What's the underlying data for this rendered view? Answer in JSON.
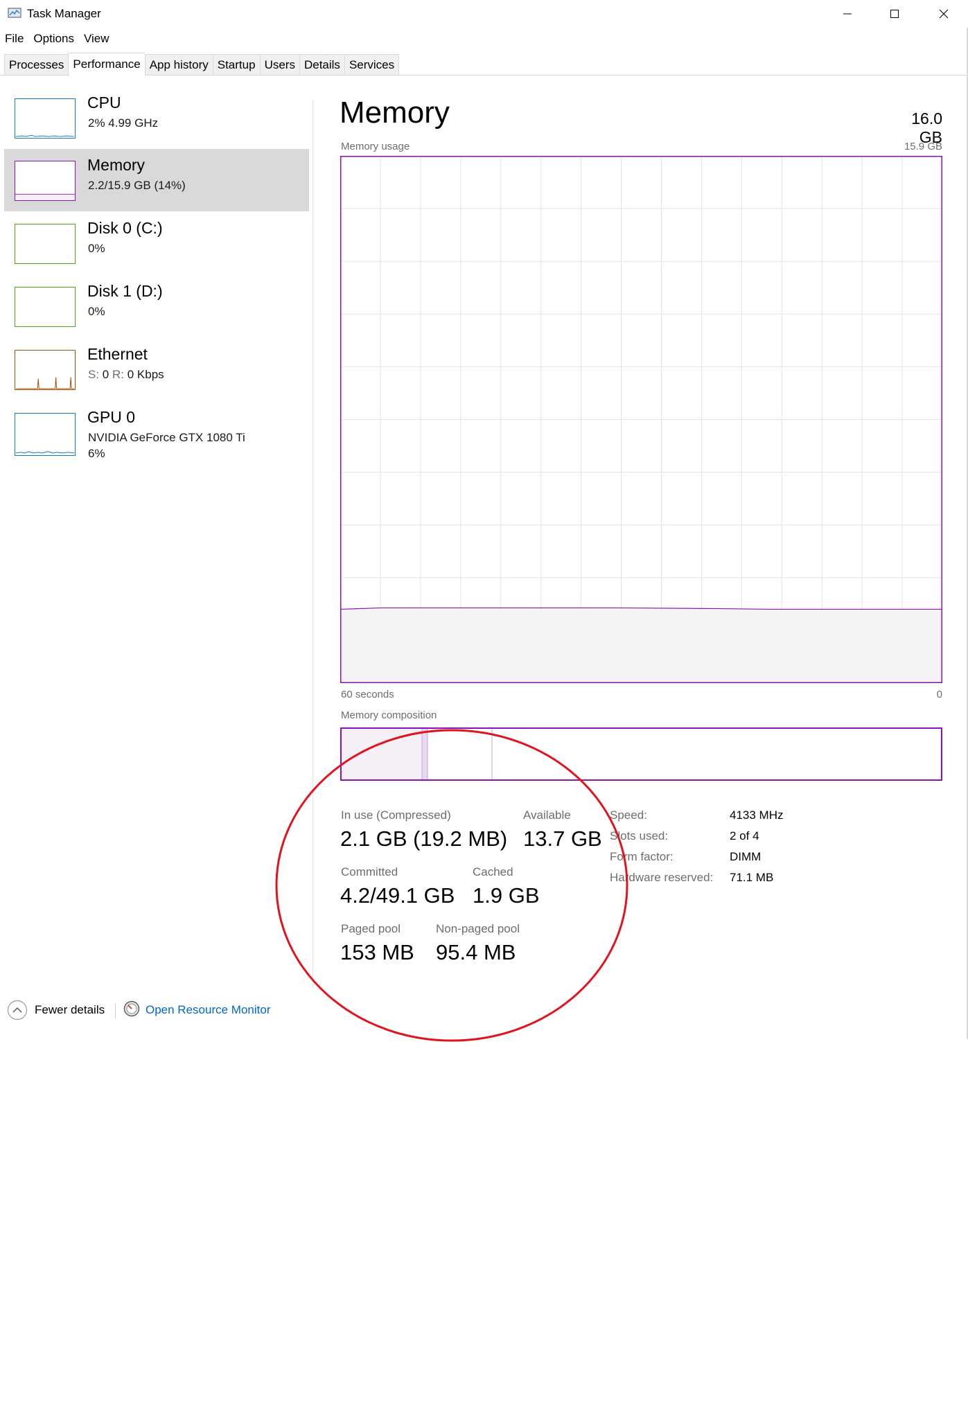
{
  "window": {
    "title": "Task Manager",
    "icon": "task-manager-icon",
    "controls": [
      "minimize-icon",
      "maximize-icon",
      "close-icon"
    ]
  },
  "menu": {
    "items": [
      "File",
      "Options",
      "View"
    ]
  },
  "tabs": {
    "items": [
      "Processes",
      "Performance",
      "App history",
      "Startup",
      "Users",
      "Details",
      "Services"
    ],
    "active": "Performance"
  },
  "sidebar": {
    "items": [
      {
        "title": "CPU",
        "sub": "2%  4.99 GHz",
        "color": "#117dbb"
      },
      {
        "title": "Memory",
        "sub": "2.2/15.9 GB (14%)",
        "color": "#8b12ae",
        "selected": true
      },
      {
        "title": "Disk 0 (C:)",
        "sub": "0%",
        "color": "#4da60c"
      },
      {
        "title": "Disk 1 (D:)",
        "sub": "0%",
        "color": "#4da60c"
      },
      {
        "title": "Ethernet",
        "sub_s_label": "S:",
        "sub_s_value": "0",
        "sub_r_label": "R:",
        "sub_r_value": "0 Kbps",
        "color": "#a74f01"
      },
      {
        "title": "GPU 0",
        "sub": "NVIDIA GeForce GTX 1080 Ti",
        "sub2": "6%",
        "color": "#117dbb"
      }
    ]
  },
  "memory": {
    "title": "Memory",
    "total": "16.0 GB",
    "usage_label": "Memory usage",
    "usage_max": "15.9 GB",
    "axis_left": "60 seconds",
    "axis_right": "0",
    "composition_label": "Memory composition",
    "accent_color": "#8b12ae",
    "stats": {
      "in_use_label": "In use (Compressed)",
      "in_use_value": "2.1 GB (19.2 MB)",
      "available_label": "Available",
      "available_value": "13.7 GB",
      "committed_label": "Committed",
      "committed_value": "4.2/49.1 GB",
      "cached_label": "Cached",
      "cached_value": "1.9 GB",
      "paged_label": "Paged pool",
      "paged_value": "153 MB",
      "nonpaged_label": "Non-paged pool",
      "nonpaged_value": "95.4 MB"
    },
    "specs": {
      "speed_label": "Speed:",
      "speed_value": "4133 MHz",
      "slots_label": "Slots used:",
      "slots_value": "2 of 4",
      "form_label": "Form factor:",
      "form_value": "DIMM",
      "reserved_label": "Hardware reserved:",
      "reserved_value": "71.1 MB"
    },
    "usage_fraction": 0.14
  },
  "footer": {
    "fewer_details": "Fewer details",
    "fewer_icon": "chevron-up-circle-icon",
    "resource_monitor": "Open Resource Monitor",
    "resource_icon": "resource-monitor-icon"
  },
  "annotation": {
    "color": "#e0141e"
  }
}
